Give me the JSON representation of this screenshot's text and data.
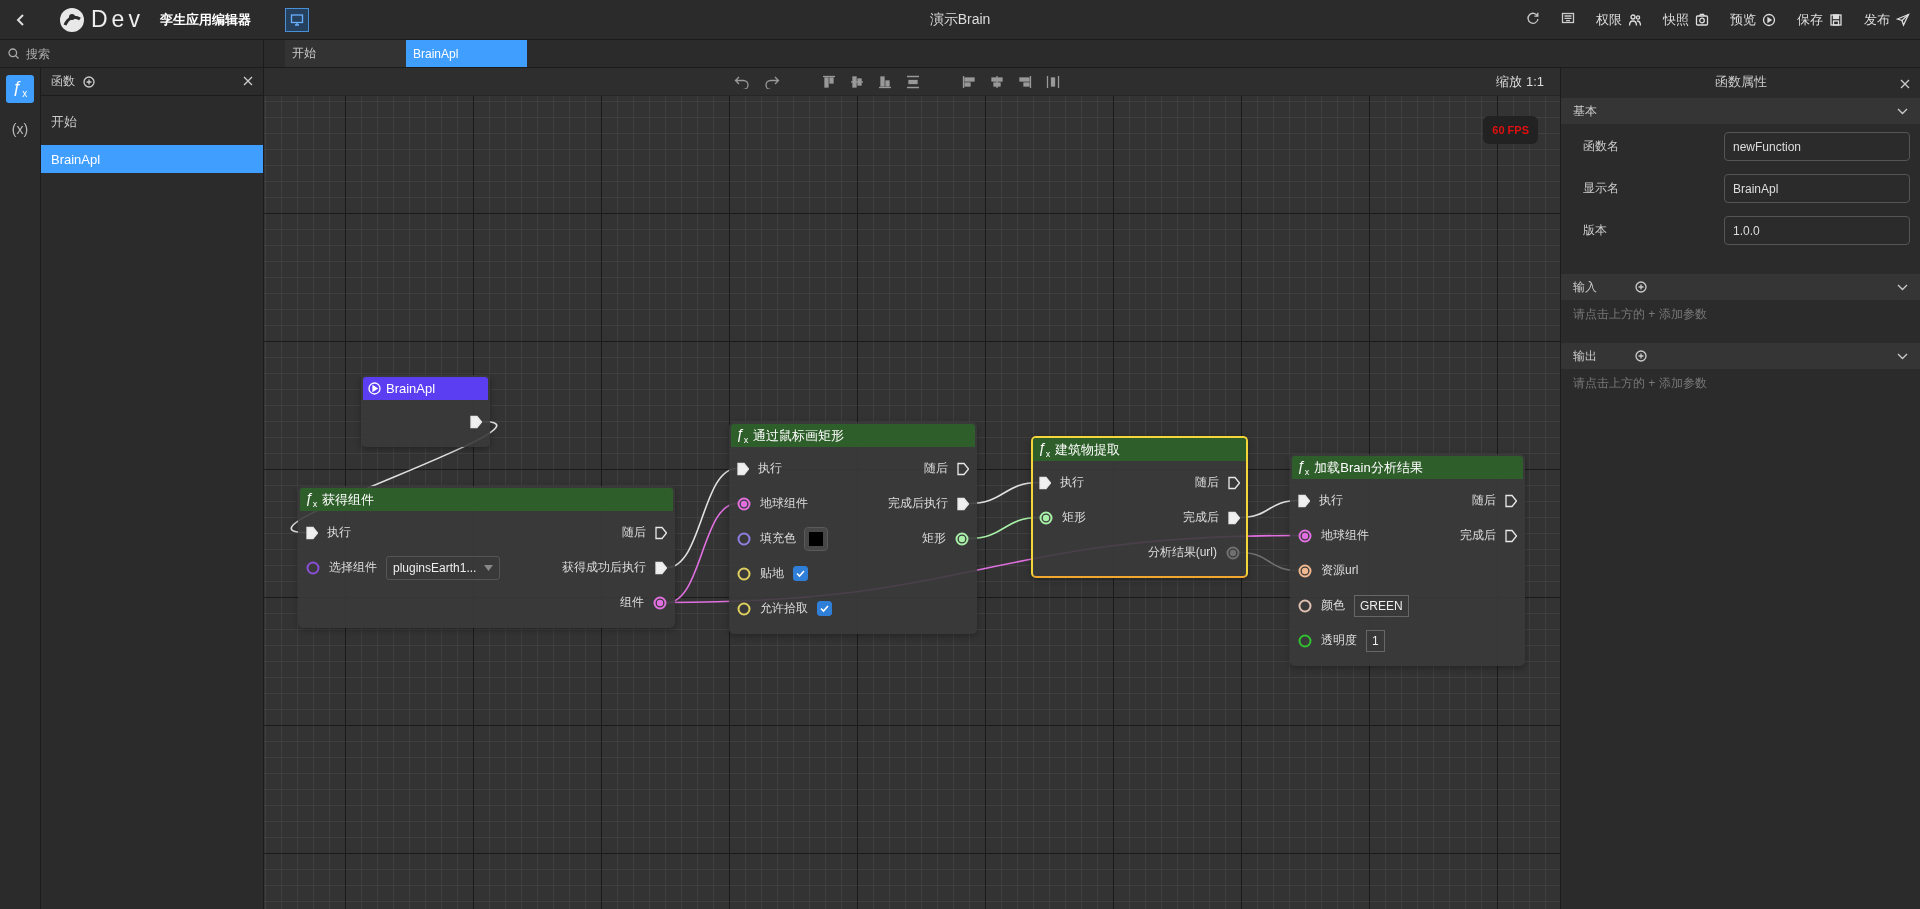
{
  "topbar": {
    "logo_text": "Dev",
    "app_name": "孪生应用编辑器",
    "screen_toggle": {
      "on": true
    },
    "title": "演示Brain",
    "actions": [
      {
        "kind": "refresh"
      },
      {
        "kind": "keyboard"
      },
      {
        "kind": "users",
        "label": "权限"
      },
      {
        "kind": "camera",
        "label": "快照"
      },
      {
        "kind": "play",
        "label": "预览"
      },
      {
        "kind": "save",
        "label": "保存"
      },
      {
        "kind": "send",
        "label": "发布"
      }
    ]
  },
  "search": {
    "placeholder": "搜索"
  },
  "tabs": [
    {
      "label": "开始",
      "selected": false
    },
    {
      "label": "BrainApl",
      "selected": true
    }
  ],
  "rail": [
    {
      "label": "ƒ$_{x}$",
      "selected": true
    },
    {
      "label": "(x)",
      "selected": false
    }
  ],
  "functions_panel": {
    "title": "函数",
    "items": [
      {
        "label": "开始",
        "selected": false
      },
      {
        "label": "BrainApl",
        "selected": true
      }
    ]
  },
  "canvas": {
    "zoom_label": "缩放 1:1",
    "fps": "60 FPS",
    "nodes": [
      {
        "kind": "event",
        "title": "BrainApl",
        "selected": false,
        "outputs": [
          {
            "kind": "exec",
            "connected": true
          }
        ]
      },
      {
        "kind": "function",
        "icon_text": "ƒ$_{x}$",
        "title": "获得组件",
        "selected": false,
        "inputs": [
          {
            "kind": "exec",
            "label": "执行",
            "connected": true
          },
          {
            "kind": "data",
            "label": "选择组件",
            "color": "#8a4fd8",
            "connected": false,
            "control": {
              "kind": "select",
              "value": "pluginsEarth1..."
            }
          }
        ],
        "outputs": [
          {
            "kind": "exec",
            "label": "随后",
            "connected": false
          },
          {
            "kind": "exec",
            "label": "获得成功后执行",
            "connected": true
          },
          {
            "kind": "data",
            "label": "组件",
            "color": "#e070e0",
            "connected": true
          }
        ]
      },
      {
        "kind": "function",
        "icon_text": "ƒ$_{x}$",
        "title": "通过鼠标画矩形",
        "selected": false,
        "inputs": [
          {
            "kind": "exec",
            "label": "执行",
            "connected": true
          },
          {
            "kind": "data",
            "label": "地球组件",
            "color": "#e070e0",
            "connected": true
          },
          {
            "kind": "data",
            "label": "填充色",
            "color": "#8f7fe0",
            "connected": false,
            "control": {
              "kind": "swatch",
              "color": "#000000"
            }
          },
          {
            "kind": "data",
            "label": "贴地",
            "color": "#e0d060",
            "connected": false,
            "control": {
              "kind": "checkbox",
              "checked": true
            }
          },
          {
            "kind": "data",
            "label": "允许拾取",
            "color": "#e0d060",
            "connected": false,
            "control": {
              "kind": "checkbox",
              "checked": true
            }
          }
        ],
        "outputs": [
          {
            "kind": "exec",
            "label": "随后",
            "connected": false
          },
          {
            "kind": "exec",
            "label": "完成后执行",
            "connected": true
          },
          {
            "kind": "data",
            "label": "矩形",
            "color": "#a8f0a8",
            "connected": true
          }
        ]
      },
      {
        "kind": "function",
        "icon_text": "ƒ$_{x}$",
        "title": "建筑物提取",
        "selected": true,
        "inputs": [
          {
            "kind": "exec",
            "label": "执行",
            "connected": true
          },
          {
            "kind": "data",
            "label": "矩形",
            "color": "#a8f0a8",
            "connected": true
          }
        ],
        "outputs": [
          {
            "kind": "exec",
            "label": "随后",
            "connected": false
          },
          {
            "kind": "exec",
            "label": "完成后",
            "connected": true
          },
          {
            "kind": "data",
            "label": "分析结果(url)",
            "color": "#707070",
            "connected": true
          }
        ]
      },
      {
        "kind": "function",
        "icon_text": "ƒ$_{x}$",
        "title": "加载Brain分析结果",
        "selected": false,
        "inputs": [
          {
            "kind": "exec",
            "label": "执行",
            "connected": true
          },
          {
            "kind": "data",
            "label": "地球组件",
            "color": "#e070e0",
            "connected": true
          },
          {
            "kind": "data",
            "label": "资源url",
            "color": "#f0b890",
            "connected": true
          },
          {
            "kind": "data",
            "label": "颜色",
            "color": "#e0c0b0",
            "connected": false,
            "control": {
              "kind": "text",
              "value": "GREEN"
            }
          },
          {
            "kind": "data",
            "label": "透明度",
            "color": "#30c030",
            "connected": false,
            "control": {
              "kind": "text",
              "value": "1"
            }
          }
        ],
        "outputs": [
          {
            "kind": "exec",
            "label": "随后",
            "connected": false
          },
          {
            "kind": "exec",
            "label": "完成后",
            "connected": false
          }
        ]
      }
    ]
  },
  "properties": {
    "title": "函数属性",
    "sections": [
      {
        "title": "基本",
        "expanded": true,
        "add_button": false,
        "fields": [
          {
            "label": "函数名",
            "value": "newFunction"
          },
          {
            "label": "显示名",
            "value": "BrainApl"
          },
          {
            "label": "版本",
            "value": "1.0.0"
          }
        ]
      },
      {
        "title": "输入",
        "expanded": true,
        "add_button": true,
        "hint": "请点击上方的 + 添加参数"
      },
      {
        "title": "输出",
        "expanded": true,
        "add_button": true,
        "hint": "请点击上方的 + 添加参数"
      }
    ]
  }
}
